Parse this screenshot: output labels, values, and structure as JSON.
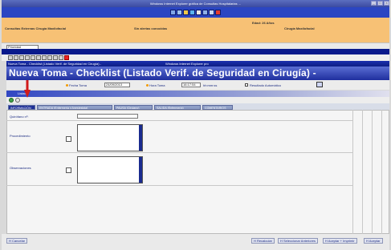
{
  "window_title": "Windows Internet Explorer gráfica de Consultas Hospitalarias ...",
  "window_controls": [
    "_",
    "□",
    "×"
  ],
  "toolbar_icons": [
    "home-icon",
    "favorites-icon",
    "person-icon",
    "mail-icon",
    "settings-icon",
    "print-icon",
    "tools-icon",
    "close-icon"
  ],
  "patient_bar": {
    "service": "Consultas Externas Cirugía Maxilofacial",
    "status": "Sin alertas conocidas",
    "age": "Edad: 26 Años",
    "department": "Cirugía Maxilofacial"
  },
  "combo_value": "Prioridad",
  "inner_window": {
    "title": "Nueva Toma - Checklist (Listado Verif. de Seguridad en Cirugía) -",
    "browser": "Windows Internet Explorer pro"
  },
  "header": {
    "title": "Nueva Toma - Checklist (Listado Verif. de Seguridad en Cirugía) -"
  },
  "form": {
    "date_label": "Fecha Toma",
    "date_value": "24/09/2013",
    "time_label": "Hora Toma",
    "time_value": "16:17:54",
    "time_unit": "hh:mm:ss",
    "auto_result_label": "Resultado Automático"
  },
  "band_title": "Listado",
  "tabs": [
    {
      "label": "INFORMACIÓN"
    },
    {
      "label": "ENTRADA (Enfermería y Anestesista)"
    },
    {
      "label": "PAUSA (Cirujano)"
    },
    {
      "label": "SALIDA (Enfermería)"
    },
    {
      "label": "COMENTARIOS"
    }
  ],
  "fields": {
    "quirofano_label": "Quirófano nº:",
    "procedimiento_label": "Procedimiento",
    "observaciones_label": "Observaciones"
  },
  "footer": {
    "cancel": "H Cancelar",
    "recalc": "H Recalcular",
    "select_prev": "H Seleccionar Anteriores",
    "accept_print": "H Aceptar + Imprimir",
    "accept": "H Aceptar"
  },
  "colors": {
    "orange_bar": "#f7c175",
    "navy": "#0a1a8c",
    "header_blue": "#1f2f9e",
    "active_tab": "#1d2f97",
    "arrow_red": "#d11a1a"
  }
}
